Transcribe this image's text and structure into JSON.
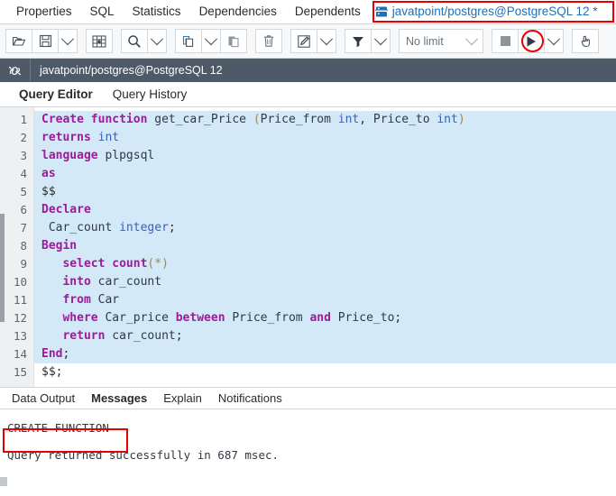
{
  "object_tabs": {
    "items": [
      {
        "label": "Properties"
      },
      {
        "label": "SQL"
      },
      {
        "label": "Statistics"
      },
      {
        "label": "Dependencies"
      },
      {
        "label": "Dependents"
      }
    ],
    "connection_tab": {
      "label": "javatpoint/postgres@PostgreSQL 12 *",
      "icon": "database-icon",
      "highlight_color": "#e60000"
    }
  },
  "toolbar": {
    "buttons": [
      {
        "name": "open-file-button",
        "icon": "open-folder-icon",
        "title": "Open File"
      },
      {
        "name": "save-file-button",
        "icon": "save-disk-icon",
        "title": "Save File"
      },
      {
        "name": "save-dropdown-button",
        "icon": "chevron-down-icon",
        "title": "Save options"
      },
      {
        "name": "edit-grid-button",
        "icon": "grid-icon",
        "title": "Edit grid"
      },
      {
        "name": "find-button",
        "icon": "search-icon",
        "title": "Find"
      },
      {
        "name": "find-dropdown-button",
        "icon": "chevron-down-icon",
        "title": "Find options"
      },
      {
        "name": "copy-button",
        "icon": "copy-icon",
        "title": "Copy"
      },
      {
        "name": "copy-dropdown-button",
        "icon": "chevron-down-icon",
        "title": "Copy options"
      },
      {
        "name": "paste-button",
        "icon": "paste-icon",
        "title": "Paste"
      },
      {
        "name": "delete-button",
        "icon": "trash-icon",
        "title": "Delete"
      },
      {
        "name": "edit-button",
        "icon": "pencil-square-icon",
        "title": "Edit"
      },
      {
        "name": "edit-dropdown-button",
        "icon": "chevron-down-icon",
        "title": "Edit options"
      },
      {
        "name": "filter-button",
        "icon": "funnel-icon",
        "title": "Filter"
      },
      {
        "name": "filter-dropdown-button",
        "icon": "chevron-down-icon",
        "title": "Filter options"
      },
      {
        "name": "stop-button",
        "icon": "stop-square-icon",
        "title": "Stop"
      },
      {
        "name": "execute-button",
        "icon": "play-triangle-icon",
        "title": "Execute"
      },
      {
        "name": "execute-dropdown-button",
        "icon": "chevron-down-icon",
        "title": "Execute options"
      },
      {
        "name": "macro-button",
        "icon": "hand-pointer-icon",
        "title": "Macros"
      }
    ],
    "limit_select": {
      "value": "No limit",
      "icon": "chevron-down-icon"
    },
    "execute_highlight_color": "#e60000"
  },
  "connection_bar": {
    "icon": "plug-link-icon",
    "label": "javatpoint/postgres@PostgreSQL 12"
  },
  "editor_tabs": {
    "items": [
      {
        "label": "Query Editor",
        "active": true
      },
      {
        "label": "Query History",
        "active": false
      }
    ]
  },
  "editor": {
    "line_numbers": [
      "1",
      "2",
      "3",
      "4",
      "5",
      "6",
      "7",
      "8",
      "9",
      "10",
      "11",
      "12",
      "13",
      "14",
      "15"
    ],
    "lines": [
      {
        "n": 1,
        "selected": true,
        "text": "Create function get_car_Price (Price_from int, Price_to int)"
      },
      {
        "n": 2,
        "selected": true,
        "text": "returns int"
      },
      {
        "n": 3,
        "selected": true,
        "text": "language plpgsql"
      },
      {
        "n": 4,
        "selected": true,
        "text": "as"
      },
      {
        "n": 5,
        "selected": true,
        "text": "$$"
      },
      {
        "n": 6,
        "selected": true,
        "text": "Declare"
      },
      {
        "n": 7,
        "selected": true,
        "text": " Car_count integer;"
      },
      {
        "n": 8,
        "selected": true,
        "text": "Begin"
      },
      {
        "n": 9,
        "selected": true,
        "text": "   select count(*)"
      },
      {
        "n": 10,
        "selected": true,
        "text": "   into car_count"
      },
      {
        "n": 11,
        "selected": true,
        "text": "   from Car"
      },
      {
        "n": 12,
        "selected": true,
        "text": "   where Car_price between Price_from and Price_to;"
      },
      {
        "n": 13,
        "selected": true,
        "text": "   return car_count;"
      },
      {
        "n": 14,
        "selected": true,
        "text": "End;"
      },
      {
        "n": 15,
        "selected": false,
        "text": "$$;"
      }
    ],
    "colors": {
      "keyword": "#a0189b",
      "type": "#3461c9",
      "paren": "#9b8a4a",
      "identifier": "#2f3a44",
      "selection_background": "#d4e9f7"
    }
  },
  "output_tabs": {
    "items": [
      {
        "label": "Data Output",
        "active": false
      },
      {
        "label": "Messages",
        "active": true
      },
      {
        "label": "Explain",
        "active": false
      },
      {
        "label": "Notifications",
        "active": false
      }
    ]
  },
  "messages": {
    "result": "CREATE FUNCTION",
    "status": "Query returned successfully in 687 msec.",
    "highlight_color": "#e60000"
  }
}
